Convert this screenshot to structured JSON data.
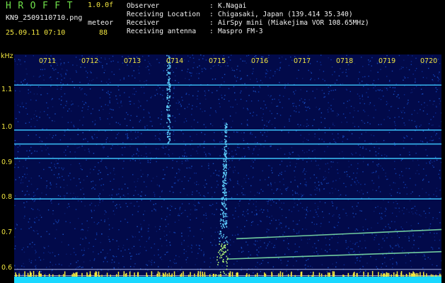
{
  "header": {
    "app_title": "HROFFT",
    "version": "1.0.0f",
    "filename": "KN9_2509110710.png",
    "timestamp": "25.09.11 07:10",
    "meteor_label": "meteor",
    "meteor_count": "88"
  },
  "metadata": [
    {
      "key": "Observer",
      "value": "K.Nagai"
    },
    {
      "key": "Receiving Location",
      "value": "Chigasaki, Japan (139.414 35.340)"
    },
    {
      "key": "Receiver",
      "value": "AirSpy mini (Miakejima VOR 108.65MHz)"
    },
    {
      "key": "Receiving antenna",
      "value": "Maspro FM-3"
    }
  ],
  "colors": {
    "background": "#000000",
    "header_green": "#6fe04a",
    "label_yellow": "#f2e640",
    "noise_blue": "#0b2a8a",
    "signal_cyan": "#3cc8ff"
  },
  "chart_data": {
    "type": "heatmap",
    "title": "",
    "y_unit_label": "kHz",
    "x_labels": [
      "0711",
      "0712",
      "0713",
      "0714",
      "0715",
      "0716",
      "0717",
      "0718",
      "0719",
      "0720"
    ],
    "y_labels": [
      "1.1",
      "1.0",
      "0.9",
      "0.8",
      "0.7",
      "0.6"
    ],
    "y_range_khz": [
      0.58,
      1.2
    ],
    "x_range_min": [
      0,
      10
    ],
    "horizontal_carriers_khz": [
      1.117,
      0.995,
      0.957,
      0.918,
      0.808,
      0.617,
      0.6
    ],
    "drifting_carriers": [
      {
        "from": [
          5.2,
          0.7
        ],
        "to": [
          10.0,
          0.725
        ]
      },
      {
        "from": [
          5.0,
          0.645
        ],
        "to": [
          10.0,
          0.665
        ]
      },
      {
        "from": [
          6.0,
          0.59
        ],
        "to": [
          10.0,
          0.598
        ]
      }
    ],
    "meteor_echoes": [
      {
        "minute": 3.6,
        "khz_top": 1.2,
        "khz_bottom": 0.96,
        "description": "faint streak"
      },
      {
        "minute": 4.95,
        "khz_top": 1.02,
        "khz_bottom": 0.58,
        "description": "bright streak"
      }
    ],
    "grid": false
  }
}
